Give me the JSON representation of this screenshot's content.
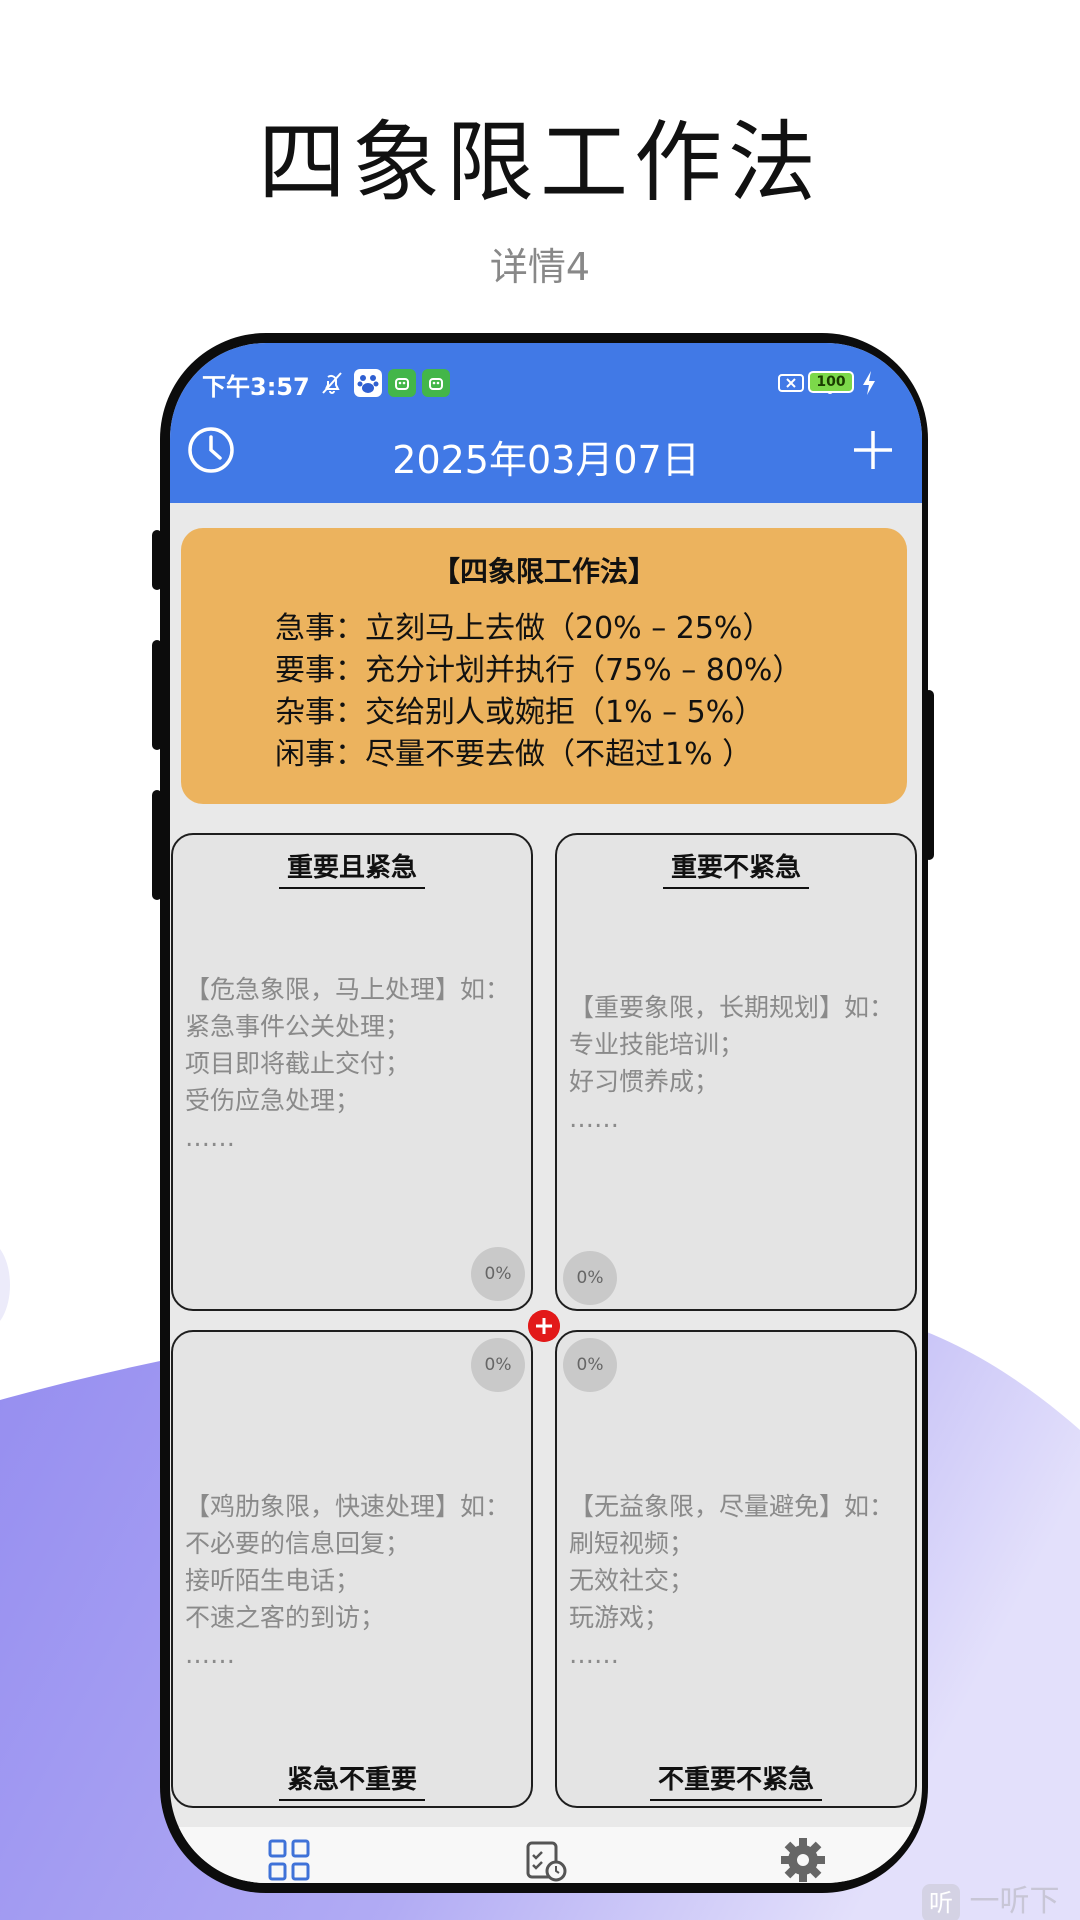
{
  "promo": {
    "title": "四象限工作法",
    "subtitle": "详情4"
  },
  "status_bar": {
    "time": "下午3:57",
    "battery": "100"
  },
  "app_bar": {
    "date": "2025年03月07日"
  },
  "info_card": {
    "title": "【四象限工作法】",
    "lines": [
      "急事：立刻马上去做（20% – 25%）",
      "要事：充分计划并执行（75% – 80%）",
      "杂事：交给别人或婉拒（1% – 5%）",
      "闲事：尽量不要去做（不超过1% ）"
    ]
  },
  "quadrants": {
    "top_left": {
      "title": "重要且紧急",
      "lines": [
        "【危急象限，马上处理】如：",
        "紧急事件公关处理；",
        "项目即将截止交付；",
        "受伤应急处理；",
        "……"
      ],
      "percent": "0%"
    },
    "top_right": {
      "title": "重要不紧急",
      "lines": [
        "【重要象限，长期规划】如：",
        "专业技能培训；",
        "好习惯养成；",
        "……"
      ],
      "percent": "0%"
    },
    "bottom_left": {
      "title": "紧急不重要",
      "lines": [
        "【鸡肋象限，快速处理】如：",
        "不必要的信息回复；",
        "接听陌生电话；",
        "不速之客的到访；",
        "……"
      ],
      "percent": "0%"
    },
    "bottom_right": {
      "title": "不重要不紧急",
      "lines": [
        "【无益象限，尽量避免】如：",
        "刷短视频；",
        "无效社交；",
        "玩游戏；",
        "……"
      ],
      "percent": "0%"
    }
  },
  "watermark": {
    "logo_char": "听",
    "text": "一听下载"
  },
  "colors": {
    "app_bar": "#4179e6",
    "info_card": "#ecb35e",
    "quadrant_bg": "#e4e4e4",
    "accent_plus": "#e21919",
    "wave": "#9f95ef"
  },
  "icons": [
    "clock-icon",
    "plus-icon",
    "quadrant-grid-icon",
    "schedule-check-icon",
    "settings-gear-icon"
  ]
}
